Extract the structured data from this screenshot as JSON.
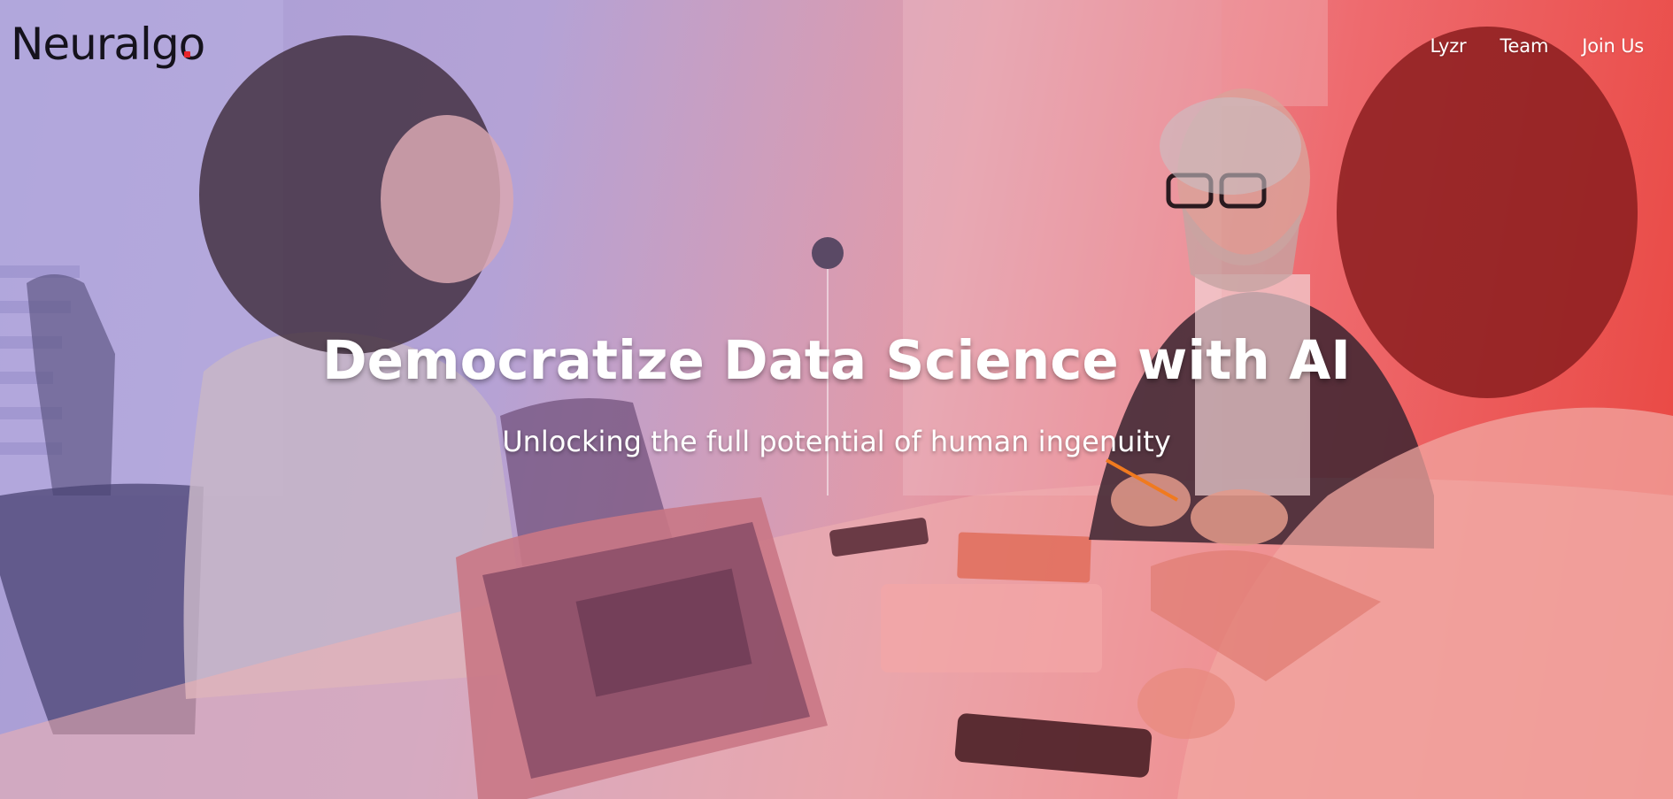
{
  "brand": {
    "logo_text": "Neuralgo",
    "accent_color": "#e8242c"
  },
  "nav": {
    "items": [
      {
        "label": "Lyzr"
      },
      {
        "label": "Team"
      },
      {
        "label": "Join Us"
      }
    ]
  },
  "hero": {
    "title": "Democratize Data Science with AI",
    "subtitle": "Unlocking the full potential of human ingenuity",
    "gradient_colors": [
      "#a89ed6",
      "#e39aa7",
      "#e9453f"
    ]
  }
}
